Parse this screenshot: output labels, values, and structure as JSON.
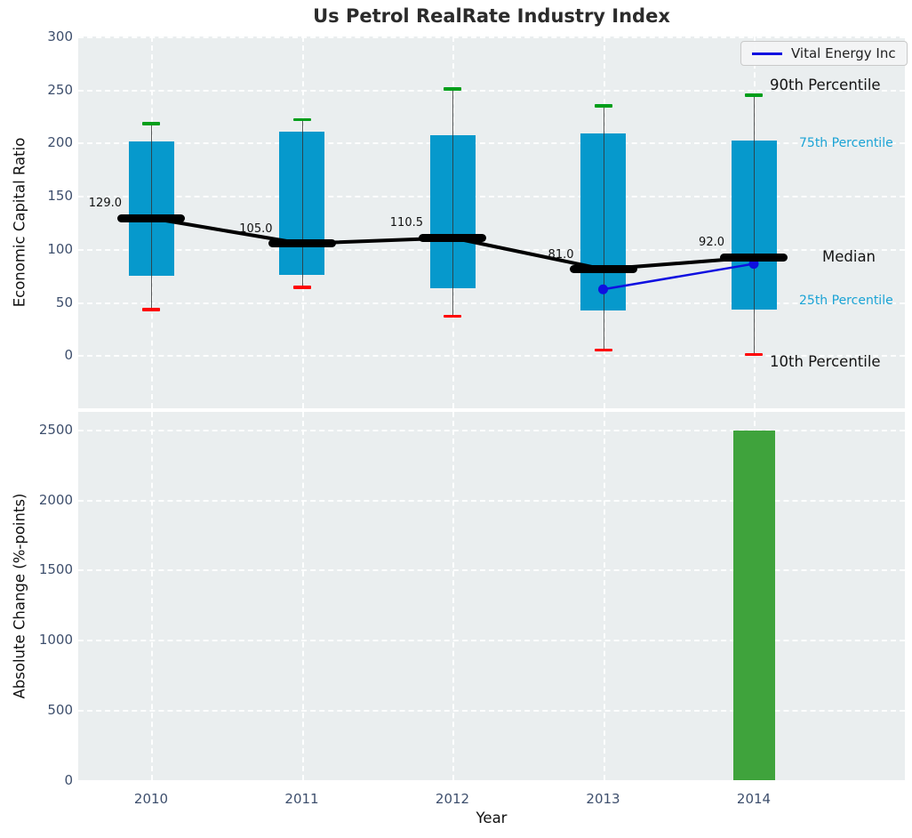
{
  "title": "Us Petrol RealRate Industry Index",
  "legend": {
    "label": "Vital Energy Inc",
    "line_color": "#0f0fe0"
  },
  "annotations": {
    "p90": "90th Percentile",
    "p75": "75th Percentile",
    "median": "Median",
    "p25": "25th Percentile",
    "p10": "10th Percentile"
  },
  "colors": {
    "box_fill": "#0699cc",
    "cap_high": "#009e1a",
    "cap_low": "#ff0000",
    "median_line": "#000000",
    "company_line": "#0f0fe0",
    "bar_fill": "#3fa33c",
    "axes_bg": "#eaeeef",
    "tick_text": "#3e4f6d",
    "cyan_label": "#1ba3d5"
  },
  "chart_data": [
    {
      "type": "boxplot-percentile",
      "title": "Us Petrol RealRate Industry Index",
      "ylabel": "Economic Capital Ratio",
      "ylim": [
        -50,
        300
      ],
      "yticks": [
        300,
        250,
        200,
        150,
        100,
        50,
        0
      ],
      "grid": true,
      "categories": [
        "2010",
        "2011",
        "2012",
        "2013",
        "2014"
      ],
      "series": [
        {
          "name": "90th Percentile",
          "values": [
            218,
            222,
            251,
            235,
            245
          ]
        },
        {
          "name": "75th Percentile",
          "values": [
            201,
            210,
            207,
            209,
            202
          ]
        },
        {
          "name": "Median",
          "values": [
            129.0,
            105.0,
            110.5,
            81.0,
            92.0
          ]
        },
        {
          "name": "25th Percentile",
          "values": [
            75,
            76,
            63,
            42,
            43
          ]
        },
        {
          "name": "10th Percentile",
          "values": [
            43,
            64,
            37,
            5,
            1
          ]
        }
      ],
      "median_labels": [
        "129.0",
        "105.0",
        "110.5",
        "81.0",
        "92.0"
      ],
      "company_series": {
        "name": "Vital Energy Inc",
        "categories": [
          "2013",
          "2014"
        ],
        "values": [
          62,
          86
        ]
      },
      "legend_position": "upper right"
    },
    {
      "type": "bar",
      "xlabel": "Year",
      "ylabel": "Absolute Change (%-points)",
      "ylim": [
        0,
        2625
      ],
      "yticks": [
        2500,
        2000,
        1500,
        1000,
        500,
        0
      ],
      "grid": true,
      "categories": [
        "2010",
        "2011",
        "2012",
        "2013",
        "2014"
      ],
      "values": [
        null,
        null,
        null,
        null,
        2490
      ]
    }
  ]
}
